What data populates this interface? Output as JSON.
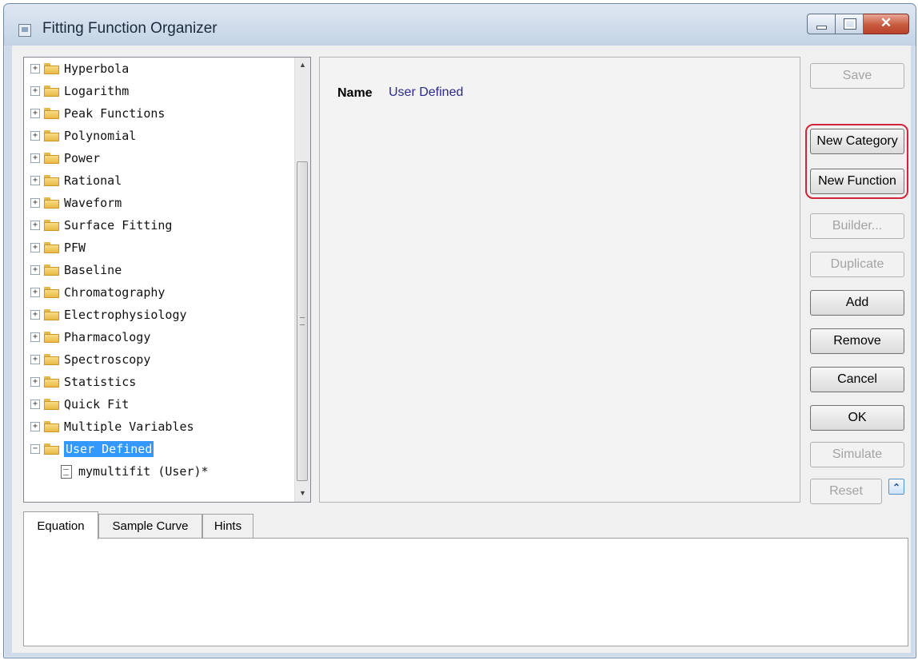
{
  "window": {
    "title": "Fitting Function Organizer"
  },
  "tree": {
    "categories": [
      "Hyperbola",
      "Logarithm",
      "Peak Functions",
      "Polynomial",
      "Power",
      "Rational",
      "Waveform",
      "Surface Fitting",
      "PFW",
      "Baseline",
      "Chromatography",
      "Electrophysiology",
      "Pharmacology",
      "Spectroscopy",
      "Statistics",
      "Quick Fit",
      "Multiple Variables"
    ],
    "selected": "User Defined",
    "child": "mymultifit (User)*"
  },
  "detail": {
    "name_label": "Name",
    "name_value": "User Defined"
  },
  "buttons": {
    "save": "Save",
    "new_category": "New Category",
    "new_function": "New Function",
    "builder": "Builder...",
    "duplicate": "Duplicate",
    "add": "Add",
    "remove": "Remove",
    "cancel": "Cancel",
    "ok": "OK",
    "simulate": "Simulate",
    "reset": "Reset"
  },
  "tabs": [
    "Equation",
    "Sample Curve",
    "Hints"
  ],
  "accent": {
    "highlight": "#d0253a",
    "selection": "#3399ff"
  }
}
